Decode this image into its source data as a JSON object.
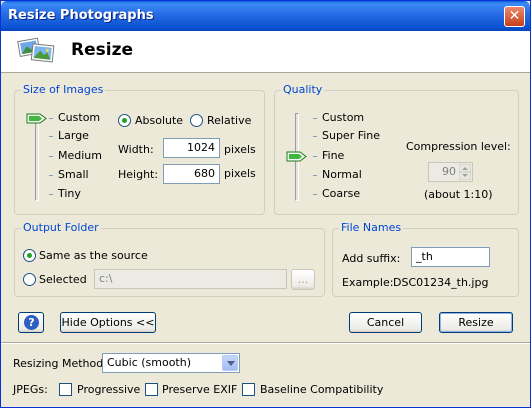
{
  "window": {
    "title": "Resize Photographs",
    "close_glyph": "✕",
    "header_title": "Resize",
    "header_icon": "photographs-icon"
  },
  "size_of_images": {
    "legend": "Size of Images",
    "presets": [
      "Custom",
      "Large",
      "Medium",
      "Small",
      "Tiny"
    ],
    "selected_preset": "Custom",
    "mode_absolute": "Absolute",
    "mode_relative": "Relative",
    "selected_mode": "Absolute",
    "width_label": "Width:",
    "width_value": "1024",
    "height_label": "Height:",
    "height_value": "680",
    "unit": "pixels"
  },
  "quality": {
    "legend": "Quality",
    "levels": [
      "Custom",
      "Super Fine",
      "Fine",
      "Normal",
      "Coarse"
    ],
    "selected_level": "Fine",
    "compression_label": "Compression level:",
    "compression_value": "90",
    "compression_ratio": "(about 1:10)"
  },
  "output_folder": {
    "legend": "Output Folder",
    "same_label": "Same as the source",
    "selected_label": "Selected",
    "selected_option": "Same as the source",
    "path_value": "c:\\",
    "browse_label": "..."
  },
  "file_names": {
    "legend": "File Names",
    "suffix_label": "Add suffix:",
    "suffix_value": "_th",
    "example_label": "Example:",
    "example_value": "DSC01234_th.jpg"
  },
  "buttons": {
    "help": "?",
    "hide_options": "Hide Options <<",
    "cancel": "Cancel",
    "resize": "Resize"
  },
  "options": {
    "method_label": "Resizing Method",
    "method_value": "Cubic (smooth)",
    "jpegs_label": "JPEGs:",
    "progressive": "Progressive",
    "preserve_exif": "Preserve EXIF",
    "baseline": "Baseline Compatibility",
    "progressive_checked": false,
    "preserve_exif_checked": false,
    "baseline_checked": false
  },
  "colors": {
    "titlebar": "#0a52d4",
    "group_legend": "#0046d5",
    "dialog_bg": "#ece9d8",
    "radio_dot": "#21a121"
  }
}
